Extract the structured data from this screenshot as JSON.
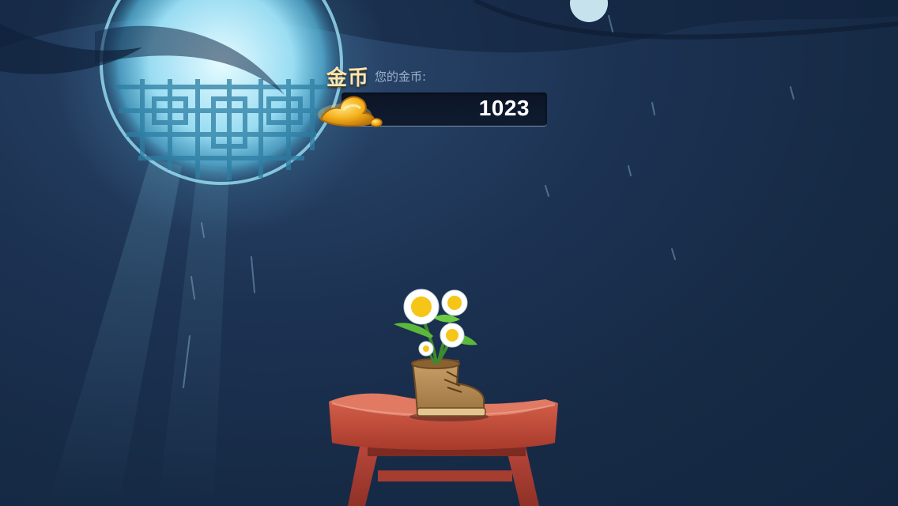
{
  "currency": {
    "title": "金币",
    "subtitle": "您的金币:",
    "amount": "1023",
    "icon": "gold-ingot-icon"
  },
  "scene": {
    "moon_window": "moon-lattice-window",
    "plant": "flower-in-boot",
    "pedestal": "red-wooden-stand"
  },
  "colors": {
    "background": "#1c3252",
    "moon_glow": "#bfeeff",
    "gold": "#f5b21e",
    "stand": "#c4533f"
  }
}
